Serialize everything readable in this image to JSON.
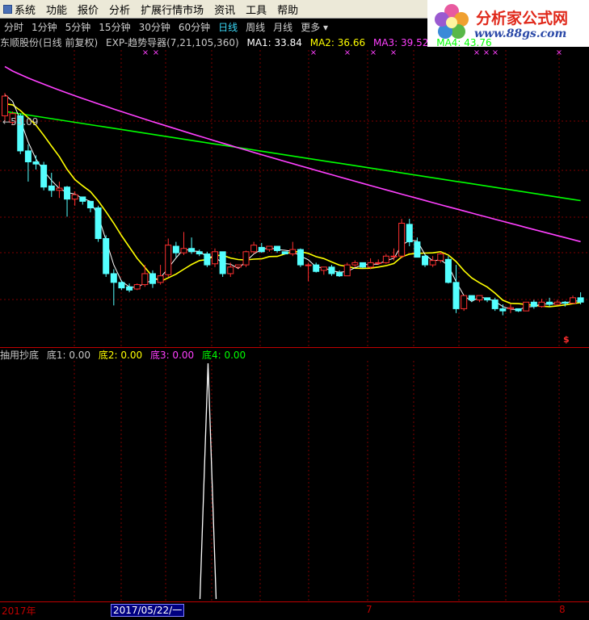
{
  "menu": {
    "items": [
      "系统",
      "功能",
      "报价",
      "分析",
      "扩展行情市场",
      "资讯",
      "工具",
      "帮助"
    ]
  },
  "logo": {
    "title": "分析家公式网",
    "url": "www.88gs.com"
  },
  "periods": {
    "items": [
      "分时",
      "1分钟",
      "5分钟",
      "15分钟",
      "30分钟",
      "60分钟",
      "日线",
      "周线",
      "月线",
      "更多"
    ],
    "active": "日线"
  },
  "main_info": {
    "stock": "东顺股份(日线 前复权)",
    "formula": "EXP-趋势导器(7,21,105,360)",
    "ma1": "MA1: 33.84",
    "ma2": "MA2: 36.66",
    "ma3": "MA3: 39.52",
    "ma4": "MA4: 43.76"
  },
  "price_label": "53.09",
  "sub_info": {
    "name": "抽用抄底",
    "d1": "底1: 0.00",
    "d2": "底2: 0.00",
    "d3": "底3: 0.00",
    "d4": "底4: 0.00"
  },
  "axis": {
    "year": "2017年",
    "cursor_date": "2017/05/22/一",
    "m7": "7",
    "m8": "8"
  },
  "signal_marker": "$",
  "colors": {
    "up": "#ff3030",
    "down": "#54ffff",
    "ma1": "#ffffff",
    "ma2": "#ffff00",
    "ma3": "#ff40ff",
    "ma4": "#00ff00",
    "grid": "#800000",
    "active_period": "#3ad9f8"
  },
  "chart_data": {
    "type": "candlestick",
    "candles": [
      [
        51,
        52.8,
        50.5,
        53.09
      ],
      [
        50.4,
        51.2,
        50.2,
        51.4
      ],
      [
        51,
        47.8,
        47.5,
        51.2
      ],
      [
        47.8,
        46.8,
        45,
        48.4
      ],
      [
        46.8,
        46.6,
        46.1,
        47.4
      ],
      [
        46.5,
        44.5,
        44.2,
        46.8
      ],
      [
        44.6,
        44.2,
        43.6,
        45.8
      ],
      [
        44.2,
        44.4,
        43.5,
        45
      ],
      [
        44.5,
        43.4,
        41.8,
        44.6
      ],
      [
        43.4,
        43.8,
        42.8,
        44.1
      ],
      [
        43.6,
        43.2,
        42.9,
        43.6
      ],
      [
        43.2,
        42.6,
        42.2,
        43.2
      ],
      [
        42.6,
        39.8,
        39.5,
        42.8
      ],
      [
        39.8,
        36.6,
        36.3,
        40.1
      ],
      [
        36.6,
        35.8,
        33.7,
        37
      ],
      [
        35.8,
        35.3,
        35.1,
        36
      ],
      [
        35.4,
        35.1,
        34.9,
        35.7
      ],
      [
        35.2,
        35.6,
        35.1,
        35.7
      ],
      [
        35.6,
        36.6,
        35.4,
        37.4
      ],
      [
        36.6,
        35.7,
        35.3,
        36.9
      ],
      [
        35.8,
        36.4,
        35.6,
        37.4
      ],
      [
        36.5,
        39.2,
        36.3,
        39.8
      ],
      [
        39.1,
        38.5,
        38.1,
        39.5
      ],
      [
        38.5,
        38.9,
        38.3,
        40.4
      ],
      [
        38.9,
        38.6,
        38.4,
        39.9
      ],
      [
        38.6,
        38.4,
        38.2,
        38.8
      ],
      [
        38.4,
        37.4,
        37.2,
        38.6
      ],
      [
        37.5,
        38.6,
        37.2,
        38.9
      ],
      [
        38.6,
        36.6,
        36.3,
        38.6
      ],
      [
        36.6,
        37.2,
        36.3,
        37.6
      ],
      [
        37.2,
        37.4,
        37,
        37.4
      ],
      [
        37.4,
        38.6,
        37.2,
        38.7
      ],
      [
        38.6,
        39.2,
        38.4,
        39.5
      ],
      [
        39,
        38.6,
        38.5,
        39.4
      ],
      [
        38.8,
        39.1,
        38.6,
        39.1
      ],
      [
        39.1,
        38.7,
        38.5,
        39.1
      ],
      [
        38.6,
        38.4,
        38.4,
        38.4
      ],
      [
        38.4,
        38.8,
        38.2,
        39.5
      ],
      [
        38.8,
        37.4,
        37.2,
        38.9
      ],
      [
        37.4,
        37.4,
        35.9,
        37.6
      ],
      [
        37.4,
        36.8,
        36.7,
        37.6
      ],
      [
        36.9,
        37.2,
        36.5,
        37.2
      ],
      [
        37.2,
        36.6,
        36.4,
        37.4
      ],
      [
        36.7,
        36.4,
        36.3,
        36.9
      ],
      [
        36.4,
        37.4,
        36.4,
        37.6
      ],
      [
        37.4,
        37.6,
        37.2,
        37.8
      ],
      [
        37.6,
        37.2,
        37.1,
        37.6
      ],
      [
        37.2,
        37.6,
        37,
        38
      ],
      [
        37.6,
        37.6,
        37.4,
        37.9
      ],
      [
        37.6,
        38.2,
        37.5,
        38.4
      ],
      [
        38.2,
        38.2,
        37.8,
        38.9
      ],
      [
        38.2,
        41.2,
        38,
        41.6
      ],
      [
        41.1,
        39.5,
        39.1,
        41.6
      ],
      [
        39.5,
        38.1,
        38.1,
        39.9
      ],
      [
        38.2,
        37.4,
        37.2,
        38.4
      ],
      [
        37.4,
        37.8,
        37.2,
        38.2
      ],
      [
        37.8,
        38.4,
        37.6,
        38.6
      ],
      [
        37.9,
        35.8,
        35.7,
        38.2
      ],
      [
        35.8,
        33.4,
        33,
        37.4
      ],
      [
        33.4,
        34.6,
        33.2,
        34.6
      ],
      [
        34.6,
        34.2,
        34,
        34.6
      ],
      [
        34.2,
        34.6,
        34,
        34.6
      ],
      [
        34.4,
        34.2,
        34,
        34.4
      ],
      [
        34.2,
        33.4,
        33.2,
        34.4
      ],
      [
        33.4,
        33.2,
        32.8,
        33.8
      ],
      [
        33.4,
        33.5,
        33,
        33.8
      ],
      [
        33.4,
        33.2,
        33.1,
        33.4
      ],
      [
        33.2,
        34,
        33.2,
        34
      ],
      [
        34,
        33.6,
        33.4,
        34.2
      ],
      [
        33.6,
        34,
        33.5,
        34.3
      ],
      [
        34,
        33.8,
        33.6,
        34.4
      ],
      [
        33.8,
        34,
        33.7,
        34.2
      ],
      [
        34,
        33.9,
        33.6,
        34.1
      ],
      [
        33.9,
        34.4,
        33.9,
        34.6
      ],
      [
        34.4,
        34,
        33.8,
        34.9
      ]
    ],
    "ma_values": {
      "MA1": 33.84,
      "MA2": 36.66,
      "MA3": 39.52,
      "MA4": 43.76
    },
    "indicator": {
      "name": "抽用抄底",
      "signal_index": 23,
      "signal_value": 1
    }
  }
}
